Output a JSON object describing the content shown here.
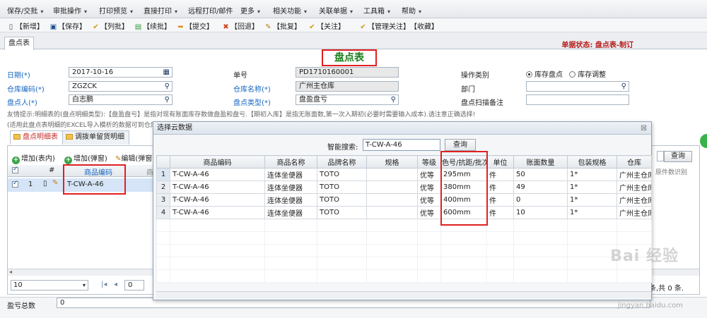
{
  "menu": [
    {
      "label": "保存/交批",
      "caret": true
    },
    {
      "label": "审批操作",
      "caret": true
    },
    {
      "label": "打印预览",
      "caret": true
    },
    {
      "label": "直接打印",
      "caret": true
    },
    {
      "label": "远程打印/邮件",
      "caret": false
    },
    {
      "label": "更多",
      "caret": true
    },
    {
      "label": "相关功能",
      "caret": true
    },
    {
      "label": "关联单据",
      "caret": true
    },
    {
      "label": "工具箱",
      "caret": true
    },
    {
      "label": "帮助",
      "caret": true
    }
  ],
  "toolbar": [
    {
      "label": "【新增】",
      "icon": "new-icon"
    },
    {
      "label": "【保存】",
      "icon": "save-icon"
    },
    {
      "label": "【列批】",
      "icon": "check-icon"
    },
    {
      "label": "【续批】",
      "icon": "book-icon"
    },
    {
      "label": "【提交】",
      "icon": "submit-icon"
    },
    {
      "label": "【回退】",
      "icon": "rollback-icon"
    },
    {
      "label": "【批复】",
      "icon": "reply-icon"
    },
    {
      "label": "【关注】",
      "icon": "follow-icon"
    },
    {
      "label": "【管理关注】",
      "icon": "manage-follow-icon"
    },
    {
      "label": "【收藏】",
      "icon": ""
    }
  ],
  "tab": {
    "label": "盘点表"
  },
  "status": {
    "text": "单据状态:  盘点表-制订"
  },
  "form": {
    "title": "盘点表",
    "date_label": "日期(*)",
    "date_value": "2017-10-16",
    "no_label": "单号",
    "no_value": "PD1710160001",
    "op_label": "操作类别",
    "op_option1": "库存盘点",
    "op_option2": "库存调整",
    "wh_code_label": "仓库编码(*)",
    "wh_code_value": "ZGZCK",
    "wh_name_label": "仓库名称(*)",
    "wh_name_value": "广州主仓库",
    "dept_label": "部门",
    "dept_value": "",
    "person_label": "盘点人(*)",
    "person_value": "白志鹏",
    "type_label": "盘点类型(*)",
    "type_value": "盘盈盘亏",
    "scan_label": "盘点扫描备注",
    "scan_value": "",
    "hint1": "友情提示:明细表的(盘点明细类型):【盘盈盘亏】是指对现有账面库存数做盘盈和盘亏.【期初入库】是指无账面数,第一次入期初(必要时需要输入成本).请注意正确选择!",
    "hint2": "(适用此盘点表明细的EXCEL导入模析的数据可到仓库"
  },
  "detail": {
    "tab1": "盘点明细表",
    "tab2": "调拨单留货明细",
    "add_inline": "增加(表内)",
    "add_popup": "增加(弹窗)",
    "edit_popup": "编辑(弹窗",
    "col_no": "#",
    "col_code": "商品编码",
    "col_cut": "商",
    "row_no": "1",
    "row_code": "T-CW-A-46",
    "right_query": "查询",
    "right_col": "原件数识别",
    "page_size": "10",
    "page_no": "0",
    "page_info": "条,共 0 条.",
    "total_label": "盈亏总数",
    "total_value": "0"
  },
  "dialog": {
    "title": "选择云数据",
    "search_label": "智能搜索:",
    "search_value": "T-CW-A-46",
    "search_button": "查询",
    "columns": [
      "",
      "商品编码",
      "商品名称",
      "品牌名称",
      "规格",
      "等级",
      "色号/抗距/批次",
      "单位",
      "账面数量",
      "包装规格",
      "仓库"
    ],
    "rows": [
      [
        "1",
        "T-CW-A-46",
        "连体坐便器",
        "TOTO",
        "",
        "优等",
        "295mm",
        "件",
        "50",
        "1*",
        "广州主仓库"
      ],
      [
        "2",
        "T-CW-A-46",
        "连体坐便器",
        "TOTO",
        "",
        "优等",
        "380mm",
        "件",
        "49",
        "1*",
        "广州主仓库"
      ],
      [
        "3",
        "T-CW-A-46",
        "连体坐便器",
        "TOTO",
        "",
        "优等",
        "400mm",
        "件",
        "0",
        "1*",
        "广州主仓库"
      ],
      [
        "4",
        "T-CW-A-46",
        "连体坐便器",
        "TOTO",
        "",
        "优等",
        "600mm",
        "件",
        "10",
        "1*",
        "广州主仓库"
      ]
    ]
  },
  "watermark": {
    "text": "Bai 经验",
    "url": "jingyan.baidu.com"
  },
  "colors": {
    "accent_red": "#e02020",
    "title_green": "#1a7f1a",
    "link_blue": "#1565c0",
    "status_red": "#b71c1c"
  }
}
